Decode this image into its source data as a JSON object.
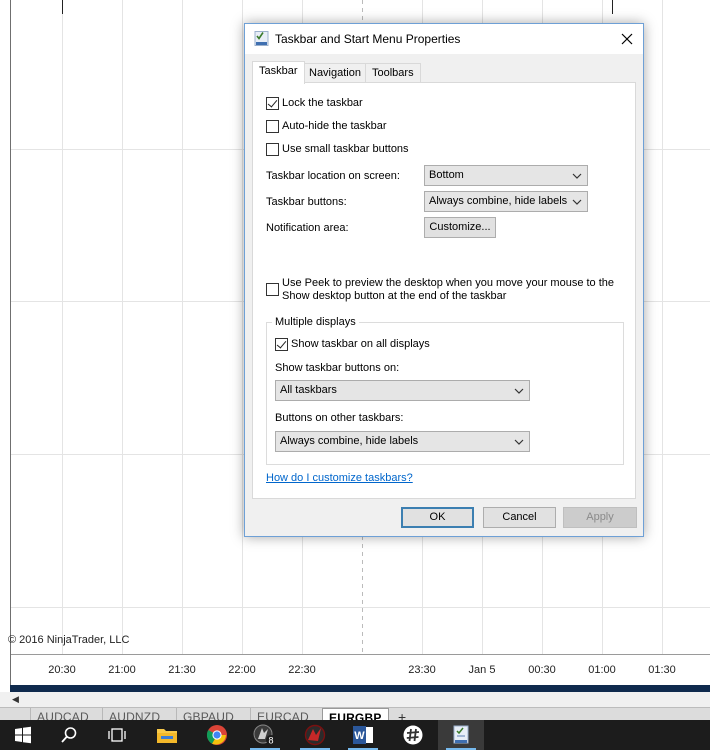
{
  "chart": {
    "copyright": "© 2016 NinjaTrader, LLC",
    "time_labels": [
      "20:30",
      "21:00",
      "21:30",
      "22:00",
      "22:30",
      "23:30",
      "Jan 5",
      "00:30",
      "01:00",
      "01:30"
    ]
  },
  "instrument_tabs": {
    "items": [
      "AUDCAD",
      "AUDNZD",
      "GBPAUD",
      "EURCAD",
      "EURGBP"
    ],
    "active": "EURGBP",
    "add_label": "+"
  },
  "dialog": {
    "title": "Taskbar and Start Menu Properties",
    "tabs": [
      "Taskbar",
      "Navigation",
      "Toolbars"
    ],
    "active_tab": "Taskbar",
    "lock_taskbar": {
      "label": "Lock the taskbar",
      "checked": true
    },
    "auto_hide": {
      "label": "Auto-hide the taskbar",
      "checked": false
    },
    "small_buttons": {
      "label": "Use small taskbar buttons",
      "checked": false
    },
    "location": {
      "label": "Taskbar location on screen:",
      "value": "Bottom"
    },
    "buttons": {
      "label": "Taskbar buttons:",
      "value": "Always combine, hide labels"
    },
    "notification": {
      "label": "Notification area:",
      "button": "Customize..."
    },
    "peek": {
      "line1": "Use Peek to preview the desktop when you move your mouse to the",
      "line2": "Show desktop button at the end of the taskbar",
      "checked": false
    },
    "multiple_displays": {
      "title": "Multiple displays",
      "show_all": {
        "label": "Show taskbar on all displays",
        "checked": true
      },
      "show_on_label": "Show taskbar buttons on:",
      "show_on_value": "All taskbars",
      "other_label": "Buttons on other taskbars:",
      "other_value": "Always combine, hide labels"
    },
    "help_link": "How do I customize taskbars?",
    "ok": "OK",
    "cancel": "Cancel",
    "apply": "Apply"
  },
  "taskbar": {
    "mail_badge": "8",
    "accent": "#76b9ed"
  }
}
